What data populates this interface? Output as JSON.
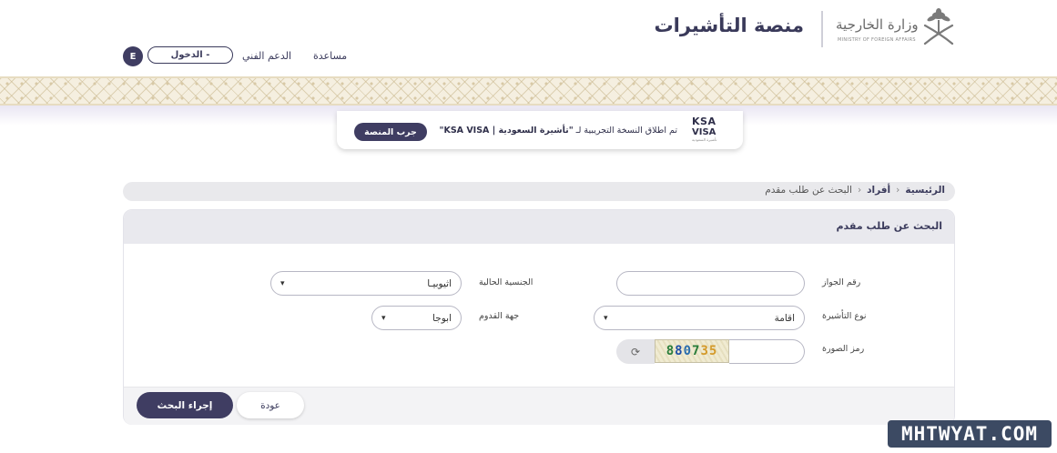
{
  "header": {
    "platform_title": "منصة التأشيرات",
    "ministry_name": "وزارة الخارجية",
    "ministry_sub": "MINISTRY OF FOREIGN AFFAIRS",
    "emblem_icon": "saudi-emblem-icon"
  },
  "nav": {
    "help": "مساعدة",
    "support": "الدعم الفني",
    "login": "الدخول -",
    "language": "E"
  },
  "promo": {
    "text_prefix": "تم اطلاق النسخة التجريبية لـ ",
    "text_bold": "\"تأشيرة السعودية | KSA VISA\"",
    "button": "جرب المنصة",
    "logo_line1": "KSA",
    "logo_line2": "VISA",
    "logo_line3": "تأشيرة السعودية"
  },
  "breadcrumb": {
    "home": "الرئيسية",
    "individuals": "أفراد",
    "current": "البحث عن طلب مقدم"
  },
  "form": {
    "title": "البحث عن طلب مقدم",
    "passport_label": "رقم الجواز",
    "passport_value": "",
    "nationality_label": "الجنسية الحالية",
    "nationality_value": "اثيوبيـا",
    "visa_type_label": "نوع التأشيرة",
    "visa_type_value": "اقامة",
    "arrival_label": "جهة القدوم",
    "arrival_value": "ابوجا",
    "captcha_label": "رمز الصورة",
    "captcha_digits": [
      "8",
      "8",
      "0",
      "7",
      "3",
      "5"
    ],
    "captcha_input_value": ""
  },
  "actions": {
    "search": "إجراء البحث",
    "back": "عودة"
  },
  "watermark": "MHTWYAT.COM",
  "colors": {
    "primary": "#3f3d62",
    "captcha": [
      "#2a7d3a",
      "#1f4fa8",
      "#2b6fae",
      "#2a7d3a",
      "#d49a2a",
      "#d49a2a"
    ]
  }
}
